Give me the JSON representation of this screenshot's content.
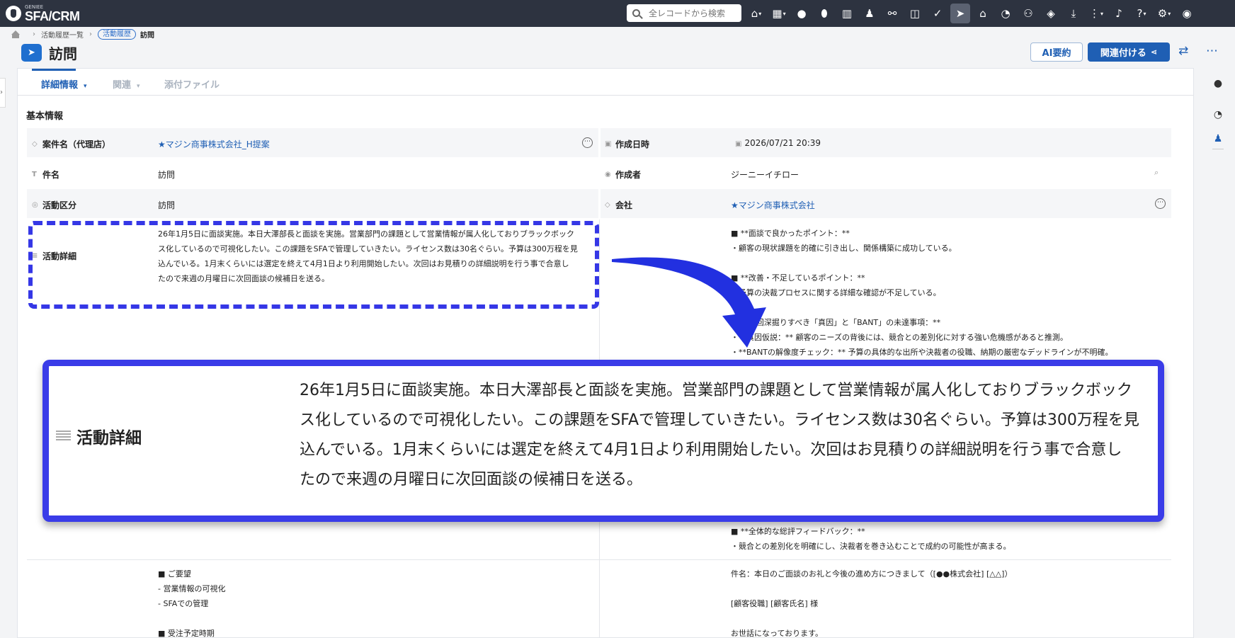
{
  "app": {
    "brand_small": "GENIEE",
    "brand": "SFA/CRM"
  },
  "search": {
    "placeholder": "全レコードから検索"
  },
  "breadcrumb": {
    "parent": "活動履歴一覧",
    "current_pill": "活動履歴",
    "current": "訪問"
  },
  "header": {
    "title": "訪問",
    "ai_button": "AI要約",
    "link_button": "関連付ける"
  },
  "tabs": [
    {
      "label": "詳細情報"
    },
    {
      "label": "関連"
    },
    {
      "label": "添付ファイル"
    }
  ],
  "section": {
    "title": "基本情報"
  },
  "fields": {
    "deal_label": "案件名（代理店）",
    "deal_value": "★マジン商事株式会社_H提案",
    "created_at_label": "作成日時",
    "created_at_value": "2026/07/21 20:39",
    "subject_label": "件名",
    "subject_value": "訪問",
    "creator_label": "作成者",
    "creator_value": "ジーニーイチロー",
    "type_label": "活動区分",
    "type_value": "訪問",
    "company_label": "会社",
    "company_value": "★マジン商事株式会社",
    "detail_label": "活動詳細",
    "detail_lines": [
      "26年1月5日に面談実施。本日大澤部長と面談を実施。営業部門の課題として営業情報が属人化しておりブラックボック",
      "ス化しているので可視化したい。この課題をSFAで管理していきたい。ライセンス数は30名ぐらい。予算は300万程を見",
      "込んでいる。1月末くらいには選定を終えて4月1日より利用開始したい。次回はお見積りの詳細説明を行う事で合意し",
      "たので来週の月曜日に次回面談の候補日を送る。"
    ]
  },
  "ai_feedback": {
    "text": "■ **面談で良かったポイント：**\n・顧客の現状課題を的確に引き出し、関係構築に成功している。\n\n■ **改善・不足しているポイント：**\n・予算の決裁プロセスに関する詳細な確認が不足している。\n\n■ **次回深掘りすべき「真因」と「BANT」の未達事項：**\n・**真因仮説：** 顧客のニーズの背後には、競合との差別化に対する強い危機感があると推測。\n・**BANTの解像度チェック：** 予算の具体的な出所や決裁者の役職、納期の厳密なデッドラインが不明確。",
    "overall": "■ **全体的な総評フィードバック：**\n・競合との差別化を明確にし、決裁者を巻き込むことで成約の可能性が高まる。"
  },
  "request_block": {
    "text": "■ ご要望\n- 営業情報の可視化\n- SFAでの管理\n\n■ 受注予定時期"
  },
  "mail_block": {
    "text": "件名：本日のご面談のお礼と今後の進め方につきまして（[●●株式会社] [△△]）\n\n[顧客役職] [顧客氏名] 様\n\nお世話になっております。"
  },
  "zoom": {
    "label": "活動詳細",
    "lines": [
      "26年1月5日に面談実施。本日大澤部長と面談を実施。営業部門の課題として営業情報が属人化しておりブラックボック",
      "ス化しているので可視化したい。この課題をSFAで管理していきたい。ライセンス数は30名ぐらい。予算は300万程を見",
      "込んでいる。1月末くらいには選定を終えて4月1日より利用開始したい。次回はお見積りの詳細説明を行う事で合意し",
      "たので来週の月曜日に次回面談の候補日を送る。"
    ]
  },
  "colors": {
    "accent": "#1f5fb4",
    "highlight": "#3a3ce8",
    "topbar": "#2d3340"
  },
  "icons": [
    "home-icon",
    "grid-icon",
    "chat-icon",
    "mouse-icon",
    "building-icon",
    "person-icon",
    "handshake-icon",
    "box-icon",
    "check-icon",
    "activity-icon",
    "bank-icon",
    "chart-icon",
    "group-icon",
    "cube-icon",
    "download-icon",
    "more-vert-icon",
    "bell-icon",
    "help-icon",
    "gear-icon",
    "avatar"
  ]
}
